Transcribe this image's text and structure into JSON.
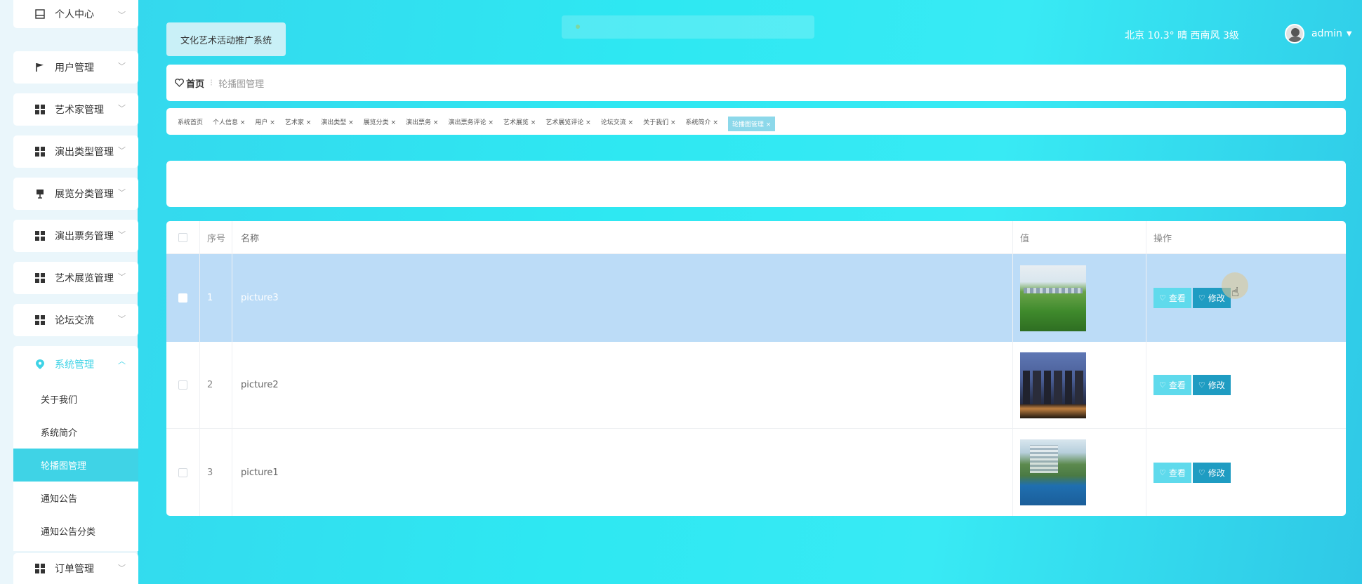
{
  "sidebar": {
    "items": [
      {
        "label": "个人中心",
        "icon": "window-icon"
      },
      {
        "label": "用户管理",
        "icon": "flag-icon"
      },
      {
        "label": "艺术家管理",
        "icon": "grid-icon"
      },
      {
        "label": "演出类型管理",
        "icon": "grid-icon"
      },
      {
        "label": "展览分类管理",
        "icon": "sign-icon"
      },
      {
        "label": "演出票务管理",
        "icon": "grid-icon"
      },
      {
        "label": "艺术展览管理",
        "icon": "grid-icon"
      },
      {
        "label": "论坛交流",
        "icon": "grid-icon"
      },
      {
        "label": "系统管理",
        "icon": "map-pin-icon"
      },
      {
        "label": "订单管理",
        "icon": "grid-icon"
      }
    ],
    "sub_items": [
      "关于我们",
      "系统简介",
      "轮播图管理",
      "通知公告",
      "通知公告分类"
    ]
  },
  "header": {
    "title": "文化艺术活动推广系统",
    "weather": "北京 10.3° 晴 西南风 3级",
    "username": "admin"
  },
  "breadcrumb": {
    "home": "首页",
    "current": "轮播图管理"
  },
  "tabs": [
    "系统首页",
    "个人信息 ×",
    "用户 ×",
    "艺术家 ×",
    "演出类型 ×",
    "展览分类 ×",
    "演出票务 ×",
    "演出票务评论 ×",
    "艺术展览 ×",
    "艺术展览评论 ×",
    "论坛交流 ×",
    "关于我们 ×",
    "系统简介 ×",
    "轮播图管理 ×"
  ],
  "table": {
    "headers": {
      "no": "序号",
      "name": "名称",
      "value": "值",
      "actions": "操作"
    },
    "rows": [
      {
        "no": "1",
        "name": "picture3",
        "thumb": "park-aerial-image",
        "selected": true
      },
      {
        "no": "2",
        "name": "picture2",
        "thumb": "city-night-image",
        "selected": false
      },
      {
        "no": "3",
        "name": "picture1",
        "thumb": "waterfront-city-image",
        "selected": false
      }
    ],
    "view_label": "查看",
    "edit_label": "修改"
  },
  "colors": {
    "accent": "#3fd3e6",
    "edit_button": "#1f9cc2",
    "view_button": "#5fdaec",
    "selected_row": "#bcdcf7"
  }
}
